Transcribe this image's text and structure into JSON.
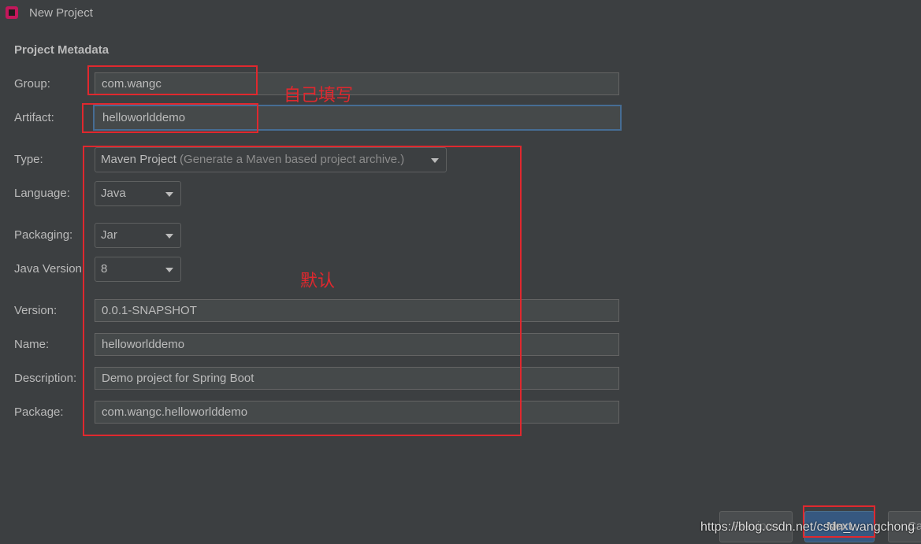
{
  "window": {
    "title": "New Project"
  },
  "section_title": "Project Metadata",
  "fields": {
    "group": {
      "label": "Group:",
      "value": "com.wangc"
    },
    "artifact": {
      "label": "Artifact:",
      "value": "helloworlddemo"
    },
    "type": {
      "label": "Type:",
      "value": "Maven Project",
      "hint": "(Generate a Maven based project archive.)"
    },
    "language": {
      "label": "Language:",
      "value": "Java"
    },
    "packaging": {
      "label": "Packaging:",
      "value": "Jar"
    },
    "java_version": {
      "label": "Java Version:",
      "value": "8"
    },
    "version": {
      "label": "Version:",
      "value": "0.0.1-SNAPSHOT"
    },
    "name": {
      "label": "Name:",
      "value": "helloworlddemo"
    },
    "description": {
      "label": "Description:",
      "value": "Demo project for Spring Boot"
    },
    "package": {
      "label": "Package:",
      "value": "com.wangc.helloworlddemo"
    }
  },
  "annotations": {
    "fill_yourself": "自己填写",
    "default": "默认"
  },
  "buttons": {
    "previous": "Previous",
    "next": "Next",
    "cancel": "Ca"
  },
  "watermark": "https://blog.csdn.net/csdn_wangchong",
  "colors": {
    "background": "#3c3f41",
    "annotation_red": "#e0282e",
    "focus_border": "#466d94",
    "primary_button": "#365880"
  },
  "icons": {
    "app": "intellij-idea-icon",
    "dropdown": "chevron-down-icon"
  }
}
